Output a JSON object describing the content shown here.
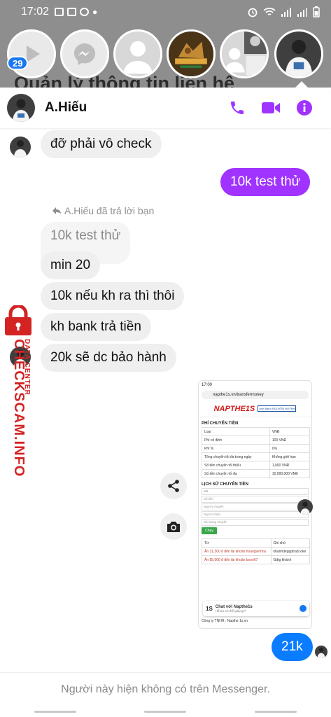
{
  "status_bar": {
    "time": "17:02"
  },
  "background_title": "Quản lý thông tin liên hệ",
  "chat_heads": {
    "badge_count": "29"
  },
  "chat_header": {
    "name": "A.Hiếu"
  },
  "messages": {
    "m1": "đỡ phải vô check",
    "m2": "10k test thử",
    "reply_note": "A.Hiếu đã trả lời bạn",
    "quoted": "10k test thử",
    "m3": "min 20",
    "m4": "10k nếu kh ra thì thôi",
    "m5": "kh bank trả tiền",
    "m6": "20k sẽ dc bảo hành",
    "m7": "21k"
  },
  "attachment": {
    "time": "17:00",
    "url": "napthe1s.vn/transfermoney",
    "brand": "NAPTHE1S",
    "brand_sub": "Ạnh Banh NGUYỄN HUỲNH",
    "fee_title": "PHÍ CHUYỂN TIỀN",
    "fee_rows": [
      [
        "Loại",
        "VNĐ"
      ],
      [
        "Phí cố định",
        "100 VNĐ"
      ],
      [
        "Phí %",
        "0%"
      ],
      [
        "Tổng chuyển tối đa trong ngày",
        "Không giới hạn"
      ],
      [
        "Số tiền chuyển tối thiểu",
        "1,000 VNĐ"
      ],
      [
        "Số tiền chuyển tối đa",
        "10,000,000 VNĐ"
      ]
    ],
    "history_title": "LỊCH SỬ CHUYỂN TIỀN",
    "fields": [
      "Mã",
      "Số tiền",
      "Người chuyển",
      "Người nhận",
      "Nội dung chuyển"
    ],
    "filter_button": "Chạy",
    "history_rows": [
      [
        "Từ",
        "Ghi chú"
      ],
      [
        "Ân 31,300 đ đến tài khoản hoangvinhnu",
        "khanhdeppptrai9 oke"
      ],
      [
        "Ân 85,000 đ đến tài khoản booo67",
        "Gdtg khánh"
      ]
    ],
    "chat_title": "Chat với Napthe1s",
    "chat_sub": "Hỗ trợ có thể giúp gì?",
    "footer": "Công ty TNHH : Napthe 1s.vn"
  },
  "watermark": {
    "main": "CHECKSCAM.INFO",
    "sub": "DATA CENTER"
  },
  "footer_text": "Người này hiện không có trên Messenger.",
  "colors": {
    "accent": "#a033ff",
    "outgoing_blue": "#0a7cff",
    "watermark": "#d42323"
  }
}
